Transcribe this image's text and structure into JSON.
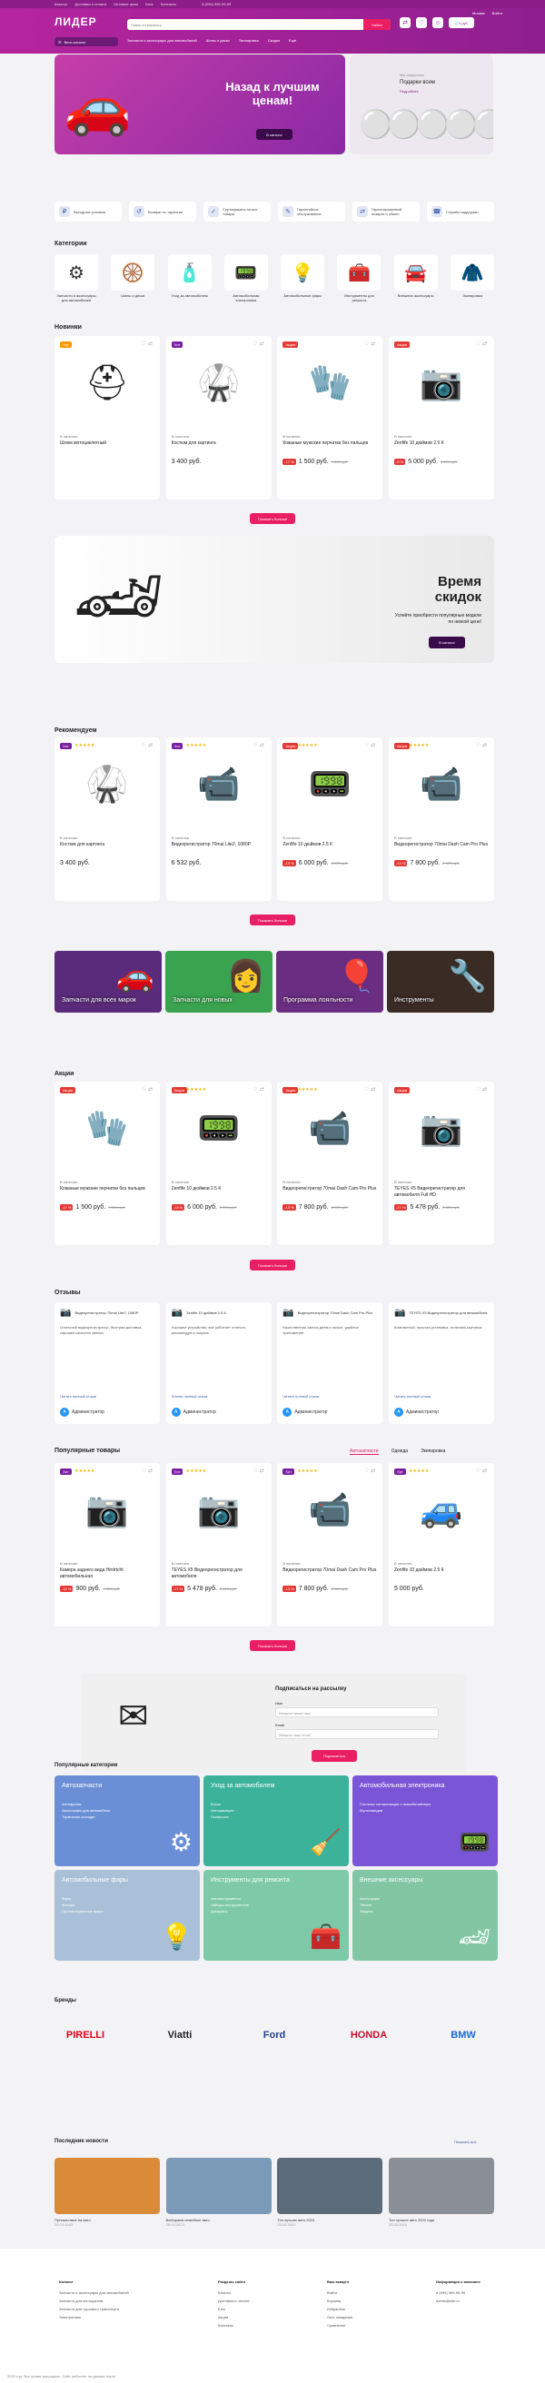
{
  "topbar": {
    "links": [
      "Каталог",
      "Доставка и оплата",
      "Оптовые цены",
      "Блог",
      "Контакты"
    ],
    "phone": "8 (999) 999-99-99"
  },
  "header": {
    "logo": "ЛИДЕР",
    "catalog_btn": "Весь каталог",
    "search_placeholder": "Поиск по каталогу",
    "search_btn": "Найти",
    "nav": [
      "Запчасти и аксессуары для автомобилей",
      "Шины и диски",
      "Экипировка",
      "Скидки",
      "Ещё"
    ],
    "cart": "0 руб.",
    "city": "Москва",
    "login": "Войти"
  },
  "hero": {
    "title": "Назад к лучшим ценам!",
    "button": "В каталог"
  },
  "hero2": {
    "subtitle": "Мы открылись",
    "title": "Подарки всем",
    "link": "Подробнее"
  },
  "features": [
    "Выгодные условия",
    "Возврат по гарантии",
    "Сертификаты на все товары",
    "Гарантийное обслуживание",
    "Гарантированный возврат и обмен",
    "Служба поддержки"
  ],
  "categories": {
    "title": "Категории",
    "items": [
      {
        "label": "Запчасти и аксессуары для автомобилей",
        "icon": "⚙"
      },
      {
        "label": "Шины и диски",
        "icon": "🛞"
      },
      {
        "label": "Уход за автомобилем",
        "icon": "🧴"
      },
      {
        "label": "Автомобильная электроника",
        "icon": "📟"
      },
      {
        "label": "Автомобильные фары",
        "icon": "💡"
      },
      {
        "label": "Инструменты для ремонта",
        "icon": "🧰"
      },
      {
        "label": "Внешние аксессуары",
        "icon": "🚘"
      },
      {
        "label": "Экипировка",
        "icon": "🧥"
      }
    ]
  },
  "novelties": {
    "title": "Новинки",
    "more": "Показать больше",
    "items": [
      {
        "name": "Шлем мотоциклетный",
        "price": "",
        "stock": "В наличии",
        "icon": "⛑",
        "badge": "Хит",
        "badge_color": "#ff9800",
        "stars": "",
        "discount": "",
        "old": ""
      },
      {
        "name": "Костюм для картинга",
        "price": "3 400 руб.",
        "stock": "В наличии",
        "icon": "🥋",
        "badge": "Хит",
        "badge_color": "#7b1fa2",
        "stars": "",
        "discount": "",
        "old": ""
      },
      {
        "name": "Кожаные мужские перчатки без пальцев",
        "price": "1 500 руб.",
        "stock": "В наличии",
        "icon": "🧤",
        "badge": "Акция",
        "badge_color": "#e53935",
        "stars": "",
        "discount": "-17 %",
        "old": "1 800 руб."
      },
      {
        "name": "Zenfife 10 дюймов 2.5 К",
        "price": "5 000 руб.",
        "stock": "В наличии",
        "icon": "📷",
        "badge": "Акция",
        "badge_color": "#e53935",
        "stars": "",
        "discount": "-5 %",
        "old": "5 200 руб."
      }
    ]
  },
  "promo": {
    "title": "Время скидок",
    "text": "Успейте приобрести популярные модели по низкой цене!",
    "button": "В каталог"
  },
  "recommend": {
    "title": "Рекомендуем",
    "more": "Показать больше",
    "items": [
      {
        "name": "Костюм для картинга",
        "price": "3 400 руб.",
        "stock": "В наличии",
        "icon": "🥋",
        "badge": "Хит",
        "badge_color": "#7b1fa2",
        "stars": "★★★★★",
        "discount": "",
        "old": ""
      },
      {
        "name": "Видеорегистратор 70mai Lite2, 1080P",
        "price": "6 532 руб.",
        "stock": "В наличии",
        "icon": "📹",
        "badge": "Хит",
        "badge_color": "#7b1fa2",
        "stars": "★★★★★",
        "discount": "",
        "old": ""
      },
      {
        "name": "Zenfife 10 дюймов 2.5 К",
        "price": "6 000 руб.",
        "stock": "В наличии",
        "icon": "📟",
        "badge": "Акция",
        "badge_color": "#e53935",
        "stars": "★★★★★",
        "discount": "-13 %",
        "old": "6 900 руб."
      },
      {
        "name": "Видеорегистратор 70mai Dash Cam Pro Plus",
        "price": "7 800 руб.",
        "stock": "В наличии",
        "icon": "📹",
        "badge": "Акция",
        "badge_color": "#e53935",
        "stars": "★★★★★",
        "discount": "-13 %",
        "old": "8 900 руб."
      }
    ]
  },
  "promos": [
    {
      "label": "Запчасти для всех марок",
      "color": "#5a2b7a",
      "icon": "🚗"
    },
    {
      "label": "Запчасти для новых",
      "color": "#3aa34f",
      "icon": "👩"
    },
    {
      "label": "Программа лояльности",
      "color": "#6a2d82",
      "icon": "🎈"
    },
    {
      "label": "Инструменты",
      "color": "#3b2b25",
      "icon": "🔧"
    }
  ],
  "sales": {
    "title": "Акции",
    "more": "Показать больше",
    "items": [
      {
        "name": "Кожаные мужские перчатки без пальцев",
        "price": "1 500 руб.",
        "stock": "В наличии",
        "icon": "🧤",
        "badge": "Акция",
        "badge_color": "#e53935",
        "stars": "",
        "discount": "-17 %",
        "old": "1 800 руб."
      },
      {
        "name": "Zenfife 10 дюймов 2.5 К",
        "price": "6 000 руб.",
        "stock": "В наличии",
        "icon": "📟",
        "badge": "Акция",
        "badge_color": "#e53935",
        "stars": "★★★★★",
        "discount": "-13 %",
        "old": "6 900 руб."
      },
      {
        "name": "Видеорегистратор 70mai Dash Cam Pro Plus",
        "price": "7 800 руб.",
        "stock": "В наличии",
        "icon": "📹",
        "badge": "Акция",
        "badge_color": "#e53935",
        "stars": "★★★★★",
        "discount": "-13 %",
        "old": "8 900 руб."
      },
      {
        "name": "TEYES X5 Видеорегистратор для автомобиля Full HD",
        "price": "5 478 руб.",
        "stock": "В наличии",
        "icon": "📷",
        "badge": "Акция",
        "badge_color": "#e53935",
        "stars": "",
        "discount": "-17 %",
        "old": "6 600 руб."
      }
    ]
  },
  "reviews": {
    "title": "Отзывы",
    "items": [
      {
        "product": "Видеорегистратор 70mai Lite2, 1080P",
        "text": "Отличный видеорегистратор, быстрая доставка, хорошее качество записи.",
        "author": "Администратор",
        "link": "Читать полный отзыв"
      },
      {
        "product": "Zenfife 10 дюймов 2.5 К",
        "text": "Хорошее устройство, всё работает отлично, рекомендую к покупке.",
        "author": "Администратор",
        "link": "Читать полный отзыв"
      },
      {
        "product": "Видеорегистратор 70mai Dash Cam Pro Plus",
        "text": "Качественная запись днём и ночью, удобное приложение.",
        "author": "Администратор",
        "link": "Читать полный отзыв"
      },
      {
        "product": "TEYES X5 Видеорегистратор для автомобиля",
        "text": "Компактный, простая установка, отличная картинка.",
        "author": "Администратор",
        "link": "Читать полный отзыв"
      }
    ]
  },
  "popular": {
    "title": "Популярные товары",
    "tabs": [
      "Автозапчасти",
      "Одежда",
      "Экипировка"
    ],
    "more": "Показать больше",
    "items": [
      {
        "name": "Камера заднего вида Hirdrtcht автомобильная",
        "price": "900 руб.",
        "stock": "В наличии",
        "icon": "📷",
        "badge": "Хит",
        "badge_color": "#7b1fa2",
        "stars": "★★★★★",
        "discount": "-10 %",
        "old": "1 000 руб."
      },
      {
        "name": "TEYES X5 Видеорегистратор для автомобиля",
        "price": "5 478 руб.",
        "stock": "В наличии",
        "icon": "📷",
        "badge": "Хит",
        "badge_color": "#7b1fa2",
        "stars": "★★★★★",
        "discount": "-17 %",
        "old": "6 600 руб."
      },
      {
        "name": "Видеорегистратор 70mai Dash Cam Pro Plus",
        "price": "7 800 руб.",
        "stock": "В наличии",
        "icon": "📹",
        "badge": "Хит",
        "badge_color": "#7b1fa2",
        "stars": "★★★★★",
        "discount": "-13 %",
        "old": "8 900 руб."
      },
      {
        "name": "Zenfife 10 дюймов 2.5 К",
        "price": "5 000 руб.",
        "stock": "В наличии",
        "icon": "🚙",
        "badge": "Хит",
        "badge_color": "#7b1fa2",
        "stars": "★★★★★",
        "discount": "",
        "old": ""
      }
    ]
  },
  "subscribe": {
    "title": "Подписаться на рассылку",
    "name_label": "Имя",
    "name_placeholder": "Введите ваше имя",
    "email_label": "Email",
    "email_placeholder": "Введите ваш email",
    "button": "Подписаться"
  },
  "popcats": {
    "title": "Популярные категории",
    "items": [
      {
        "title": "Автозапчасти",
        "links": [
          "Антифризы",
          "Аксессуары для автомобиля",
          "Тормозные колодки"
        ],
        "color": "#6b8fd6",
        "icon": "⚙"
      },
      {
        "title": "Уход за автомобилем",
        "links": [
          "Воски",
          "Автошампуни",
          "Пылесосы"
        ],
        "color": "#3cb29b",
        "icon": "🧹"
      },
      {
        "title": "Автомобильная электроника",
        "links": [
          "Системы сигнализации и иммобилайзеры",
          "Мультимедиа"
        ],
        "color": "#7a55d6",
        "icon": "📟"
      },
      {
        "title": "Автомобильные фары",
        "links": [
          "Фары",
          "Фонари",
          "Противотуманные фары"
        ],
        "color": "#a9c0d8",
        "icon": "💡"
      },
      {
        "title": "Инструменты для ремонта",
        "links": [
          "Автоинструменты",
          "Наборы инструментов",
          "Домкраты"
        ],
        "color": "#7ec9a7",
        "icon": "🧰"
      },
      {
        "title": "Внешние аксессуары",
        "links": [
          "Аксессуары",
          "Тюнинг",
          "Защита"
        ],
        "color": "#82c6a3",
        "icon": "🏎"
      }
    ]
  },
  "brands": {
    "title": "Бренды",
    "items": [
      {
        "name": "PIRELLI",
        "color": "#e2001a"
      },
      {
        "name": "Viatti",
        "color": "#222"
      },
      {
        "name": "Ford",
        "color": "#1f3f8f"
      },
      {
        "name": "HONDA",
        "color": "#c8102e"
      },
      {
        "name": "BMW",
        "color": "#1c69d4"
      }
    ]
  },
  "news": {
    "title": "Последние новости",
    "all": "Показать все",
    "items": [
      {
        "title": "Путешествие на авто",
        "date": "25.03.2023",
        "color": "#d98b3a"
      },
      {
        "title": "Выбираем семейное авто",
        "date": "25.03.2023",
        "color": "#7a9ab8"
      },
      {
        "title": "Топ лучших авто 2023",
        "date": "25.03.2023",
        "color": "#5c6b7a"
      },
      {
        "title": "Топ лучших авто 2020 года",
        "date": "25.03.2023",
        "color": "#8a8f96"
      }
    ]
  },
  "footer": {
    "cols": [
      {
        "title": "Каталог",
        "links": [
          "Запчасти и аксессуары для автомобилей",
          "Запчасти для мотоциклов",
          "Запчасти для грузового транспорта",
          "Электроника"
        ]
      },
      {
        "title": "Разделы сайта",
        "links": [
          "Каталог",
          "Доставка и оплата",
          "Блог",
          "Акции",
          "Контакты"
        ]
      },
      {
        "title": "Ваш аккаунт",
        "links": [
          "Войти",
          "Корзина",
          "Избранное",
          "Лист ожидания",
          "Сравнение"
        ]
      },
      {
        "title": "Информация о магазине",
        "links": [
          "8 (999) 999-99-99",
          "admin@site.ru"
        ]
      }
    ],
    "copyright": "2023 год. Все права защищены. Сайт работает на движке Aspro"
  }
}
